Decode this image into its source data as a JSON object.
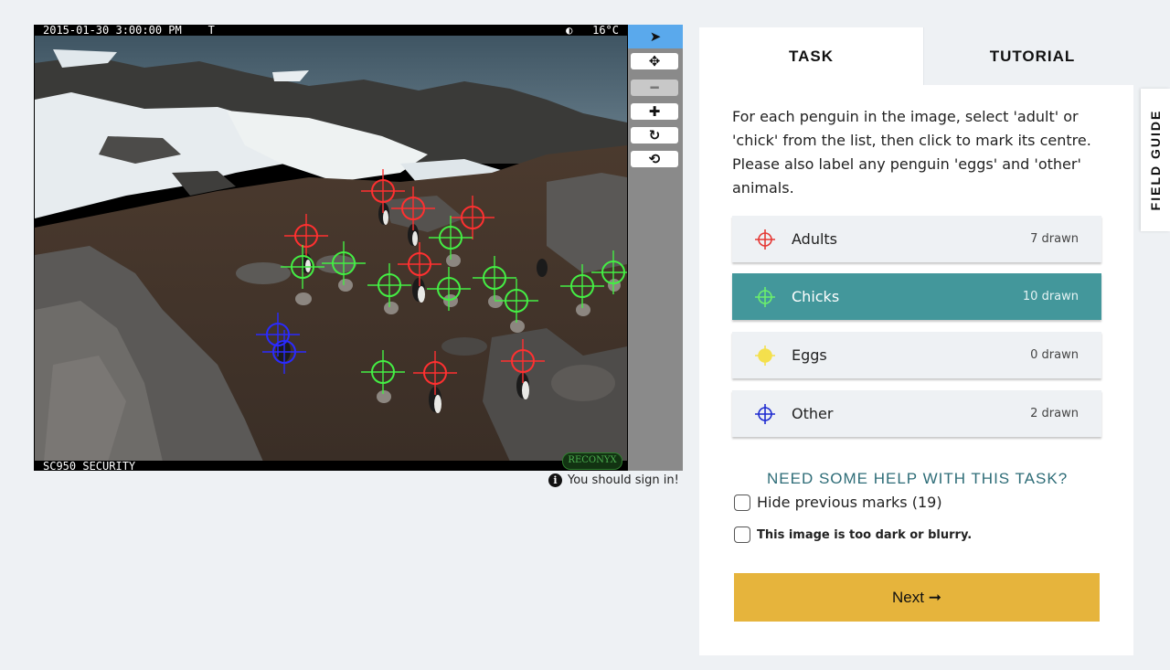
{
  "camera": {
    "timestamp": "2015-01-30 3:00:00 PM",
    "flag": "T",
    "moon": "◐",
    "temperature": "16°C",
    "model": "SC950 SECURITY",
    "brand": "RECONYX"
  },
  "toolbar": {
    "tools": [
      {
        "name": "select-tool",
        "glyph": "➤",
        "active": true
      },
      {
        "name": "pan-tool",
        "glyph": "✥"
      },
      {
        "name": "zoom-out-button",
        "glyph": "━",
        "disabled": true
      },
      {
        "name": "zoom-in-button",
        "glyph": "✚"
      },
      {
        "name": "rotate-button",
        "glyph": "↻"
      },
      {
        "name": "reset-button",
        "glyph": "⟲"
      }
    ]
  },
  "signin_notice": "You should sign in!",
  "tabs": {
    "task": "TASK",
    "tutorial": "TUTORIAL"
  },
  "task": {
    "instructions": "For each penguin in the image, select 'adult' or 'chick' from the list, then click to mark its centre. Please also label any penguin 'eggs' and 'other' animals.",
    "answers": [
      {
        "label": "Adults",
        "count": "7 drawn",
        "color": "#e53935",
        "icon": "crosshair-icon"
      },
      {
        "label": "Chicks",
        "count": "10 drawn",
        "color": "#6cf06c",
        "icon": "crosshair-icon",
        "selected": true
      },
      {
        "label": "Eggs",
        "count": "0 drawn",
        "color": "#f4e04d",
        "icon": "crosshair-icon"
      },
      {
        "label": "Other",
        "count": "2 drawn",
        "color": "#1e2bd0",
        "icon": "crosshair-icon"
      }
    ]
  },
  "help_link": "NEED SOME HELP WITH THIS TASK?",
  "hide_marks_label": "Hide previous marks (19)",
  "too_dark_label": "This image is too dark or blurry.",
  "next_label": "Next ➞",
  "field_guide_label": "FIELD GUIDE",
  "marks": [
    {
      "type": "adult",
      "color": "#ff3030"
    },
    {
      "type": "chick",
      "color": "#44ee44"
    },
    {
      "type": "other",
      "color": "#2a2aff"
    }
  ]
}
